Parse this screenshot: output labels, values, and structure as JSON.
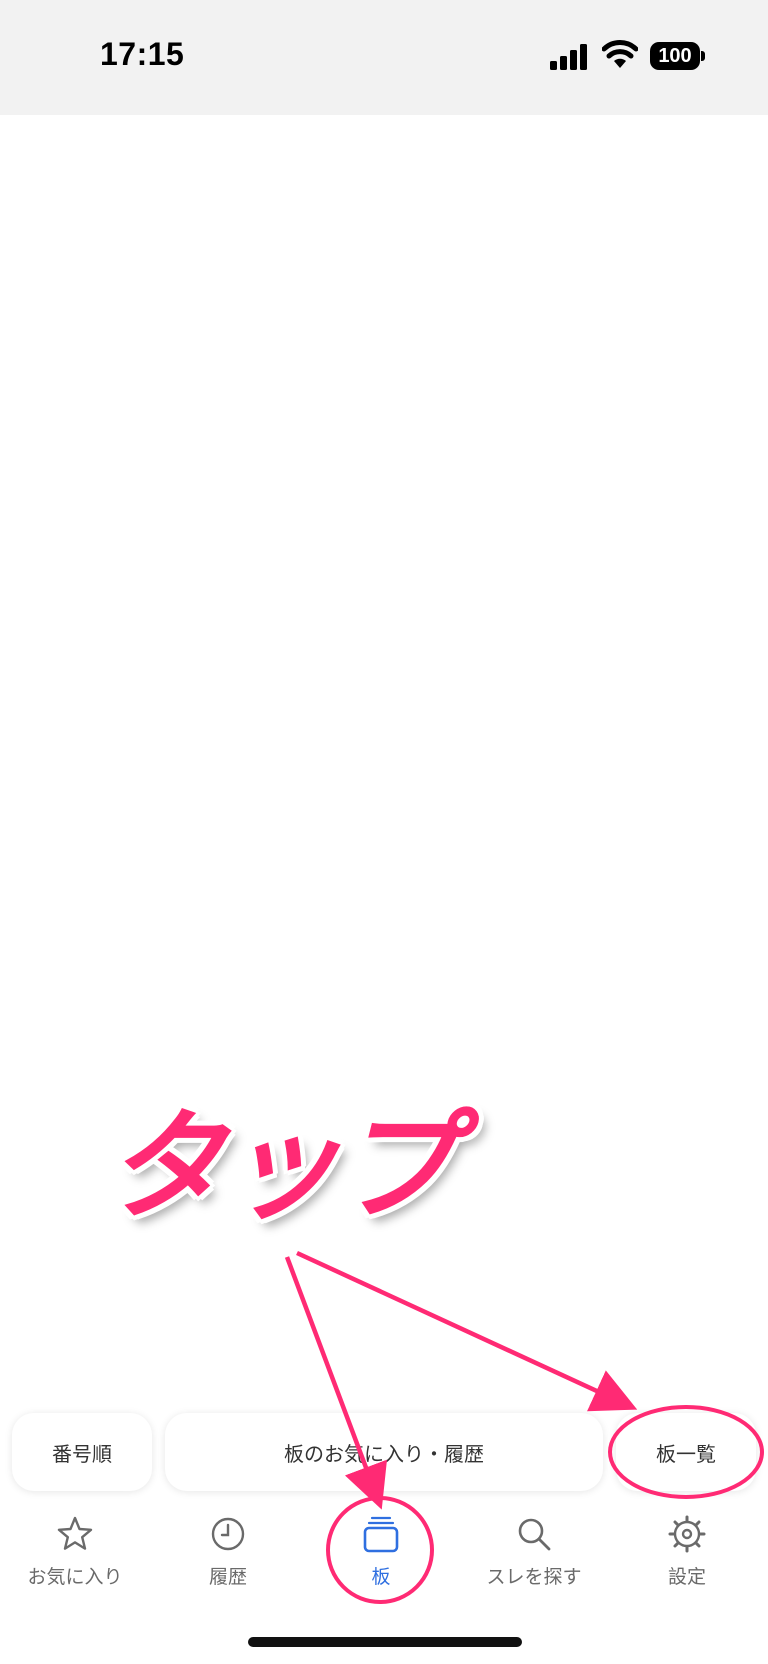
{
  "status_bar": {
    "time": "17:15",
    "battery": "100",
    "icons": [
      "signal-icon",
      "wifi-icon",
      "battery-icon"
    ]
  },
  "annotation": {
    "tap_text": "タップ",
    "color": "#ff2a74"
  },
  "toolbar": {
    "sort_label": "番号順",
    "fav_history_label": "板のお気に入り・履歴",
    "board_list_label": "板一覧"
  },
  "tabbar": {
    "accent": "#2f6fe0",
    "items": [
      {
        "label": "お気に入り",
        "icon": "star-icon"
      },
      {
        "label": "履歴",
        "icon": "clock-icon"
      },
      {
        "label": "板",
        "icon": "board-stack-icon",
        "active": true
      },
      {
        "label": "スレを探す",
        "icon": "search-icon"
      },
      {
        "label": "設定",
        "icon": "gear-icon"
      }
    ]
  }
}
